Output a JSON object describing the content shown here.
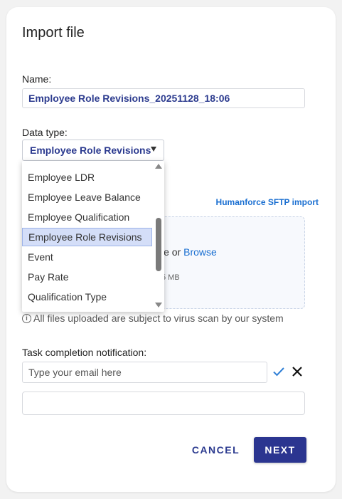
{
  "dialog": {
    "title": "Import file",
    "name_label": "Name:",
    "name_value": "Employee Role Revisions_20251128_18:06",
    "data_type_label": "Data type:",
    "data_type_selected": "Employee Role Revisions",
    "sftp_link": "Humanforce SFTP import",
    "drop_text_prefix": "file or ",
    "drop_browse": "Browse",
    "size_hint": "5 MB",
    "virus_note": "All files uploaded are subject to virus scan by our system",
    "notification_label": "Task completion notification:",
    "email_placeholder": "Type your email here",
    "cancel_label": "CANCEL",
    "next_label": "NEXT"
  },
  "dropdown": {
    "items": [
      "Employee LDR",
      "Employee Leave Balance",
      "Employee Qualification",
      "Employee Role Revisions",
      "Event",
      "Pay Rate",
      "Qualification Type"
    ],
    "selected_index": 3
  },
  "colors": {
    "accent": "#2b3590",
    "link": "#1a6fd1",
    "selected_bg": "#d4def8"
  },
  "icons": {
    "info": "info-icon",
    "confirm": "check-icon",
    "clear": "close-icon",
    "select_caret": "caret-down-icon"
  }
}
